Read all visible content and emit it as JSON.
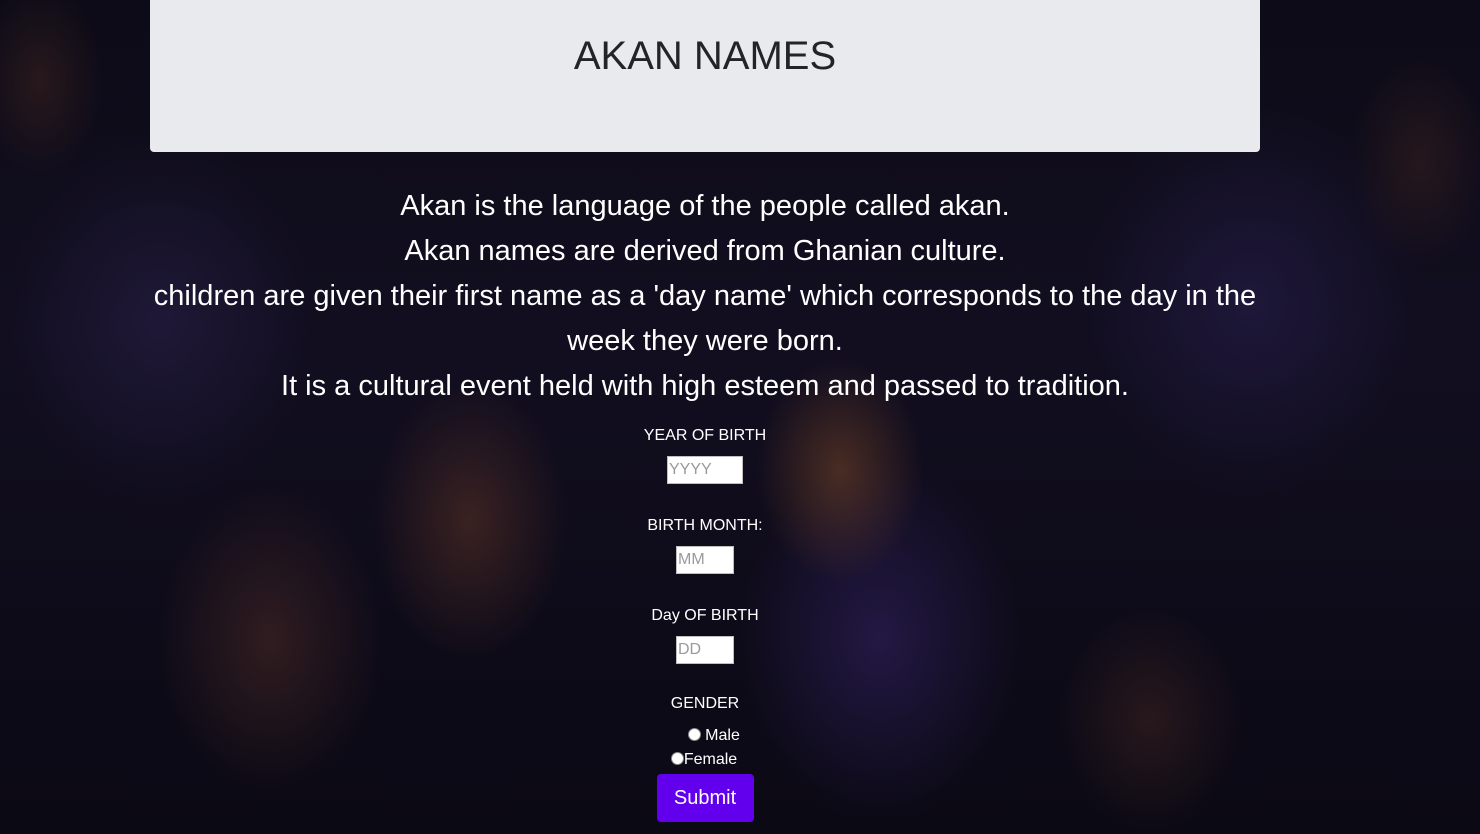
{
  "header": {
    "title": "AKAN NAMES"
  },
  "intro": {
    "line1": "Akan is the language of the people called akan.",
    "line2": "Akan names are derived from Ghanian culture.",
    "line3": "children are given their first name as a 'day name' which corresponds to the day in the week they were born.",
    "line4": "It is a cultural event held with high esteem and passed to tradition."
  },
  "form": {
    "year_label": "YEAR OF BIRTH",
    "year_placeholder": "YYYY",
    "month_label": "BIRTH MONTH:",
    "month_placeholder": "MM",
    "day_label": "Day OF BIRTH",
    "day_placeholder": "DD",
    "gender_label": "GENDER",
    "gender_options": [
      "Male",
      "Female"
    ],
    "submit_label": "Submit"
  },
  "colors": {
    "header_bg": "#e9eaee",
    "submit_bg": "#6200ee",
    "title_text": "#212529"
  }
}
